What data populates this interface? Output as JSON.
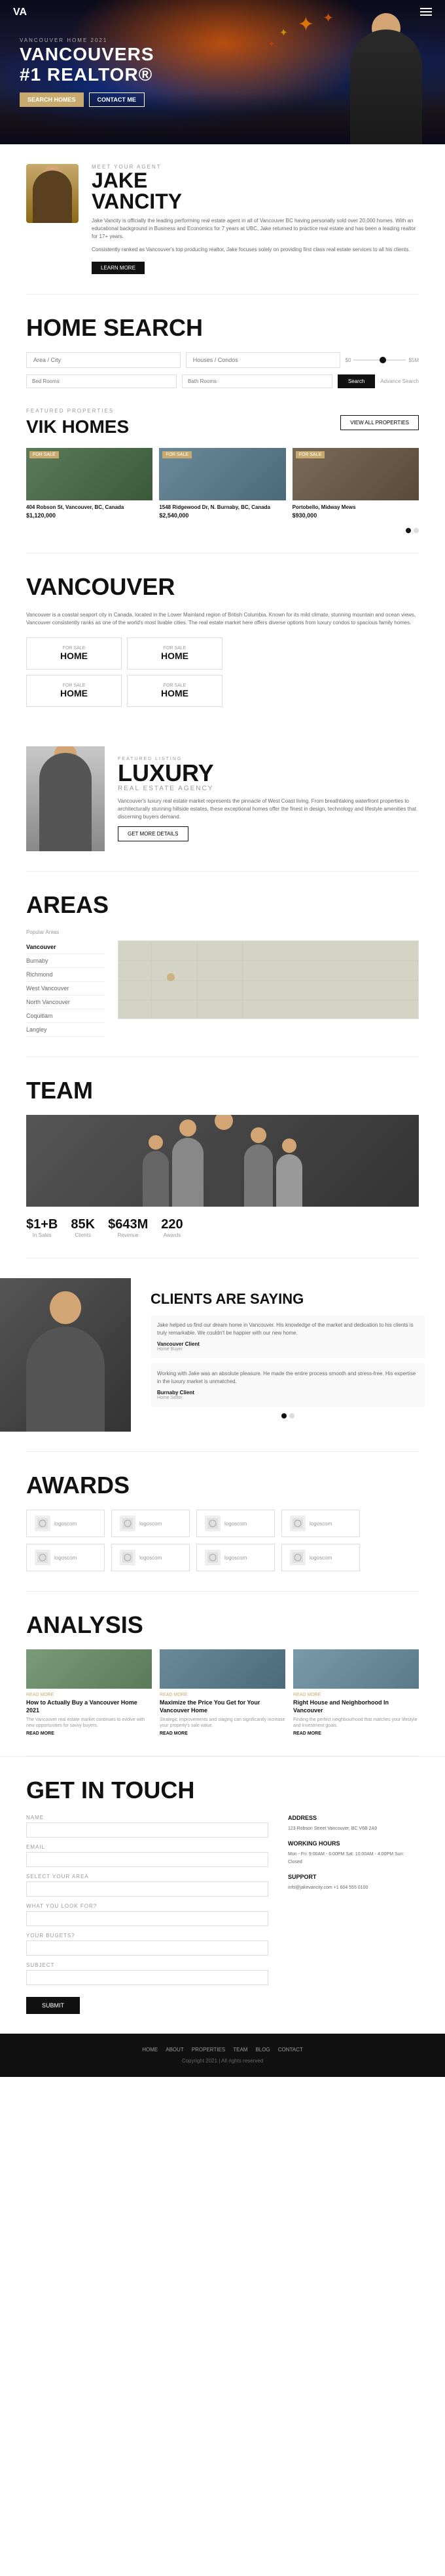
{
  "hero": {
    "logo": "VA",
    "title_line1": "VANCOUVERS",
    "title_line2": "#1 REALTOR®",
    "award_label": "Vancouver Home 2021",
    "btn_search": "SEARCH HOMES",
    "btn_contact": "CONTACT ME"
  },
  "agent": {
    "label": "MEET YOUR AGENT",
    "first_name": "JAKE",
    "last_name": "VANCITY",
    "description": "Jake Vancity is officially the leading performing real estate agent in all of Vancouver BC having personally sold over 20,000 homes. With an educational background in Business and Economics for 7 years at UBC, Jake returned to practice real estate and has been a leading realtor for 17+ years.",
    "description2": "Consistently ranked as Vancouver's top producing realtor, Jake focuses solely on providing first class real estate services to all his clients.",
    "btn": "LEARN MORE"
  },
  "home_search": {
    "title": "HOME SEARCH",
    "area_placeholder": "Area / City",
    "house_placeholder": "Houses / Condos",
    "price_min": "$0",
    "price_max": "$5M",
    "beds_placeholder": "Bed Rooms",
    "baths_placeholder": "Bath Rooms",
    "search_btn": "Search",
    "advanced_link": "Advance Search"
  },
  "featured": {
    "label": "FEATURED PROPERTIES",
    "title": "VIK HOMES",
    "homes": [
      {
        "badge": "FOR SALE",
        "address": "404 Robson St, Vancouver, BC, Canada",
        "price": "$1,120,000"
      },
      {
        "badge": "FOR SALE",
        "address": "1548 Ridgewood Dr, N. Burnaby, BC, Canada",
        "price": "$2,540,000"
      },
      {
        "badge": "FOR SALE",
        "address": "Portobello, Midway Mews",
        "price": "$930,000"
      }
    ],
    "view_all": "VIEW ALL PROPERTIES"
  },
  "vancouver": {
    "title": "VANCOUVER",
    "description": "Vancouver is a coastal seaport city in Canada, located in the Lower Mainland region of British Columbia. Known for its mild climate, stunning mountain and ocean views, Vancouver consistently ranks as one of the world's most livable cities. The real estate market here offers diverse options from luxury condos to spacious family homes.",
    "home_types": [
      {
        "label": "FOR SALE",
        "value": "HOME"
      },
      {
        "label": "FOR SALE",
        "value": "HOME"
      },
      {
        "label": "FOR SALE",
        "value": "HOME"
      },
      {
        "label": "FOR SALE",
        "value": "HOME"
      }
    ]
  },
  "luxury": {
    "label": "FEATURED LISTING",
    "title": "LUXURY",
    "subtitle": "REAL ESTATE AGENCY",
    "description": "Vancouver's luxury real estate market represents the pinnacle of West Coast living. From breathtaking waterfront properties to architecturally stunning hillside estates, these exceptional homes offer the finest in design, technology and lifestyle amenities that discerning buyers demand.",
    "btn": "GET MORE DETAILS"
  },
  "areas": {
    "title": "AREAS",
    "label": "Popular Areas",
    "items": [
      {
        "name": "Vancouver",
        "active": true
      },
      {
        "name": "Burnaby"
      },
      {
        "name": "Richmond"
      },
      {
        "name": "West Vancouver"
      },
      {
        "name": "North Vancouver"
      },
      {
        "name": "Coquitlam"
      },
      {
        "name": "Langley"
      }
    ]
  },
  "team": {
    "title": "TEAM",
    "stats": [
      {
        "value": "$1+B",
        "label": "In Sales"
      },
      {
        "value": "85K",
        "label": "Clients"
      },
      {
        "value": "$643M",
        "label": "Revenue"
      },
      {
        "value": "220",
        "label": "Awards"
      }
    ]
  },
  "clients": {
    "title": "CLIENTS ARE SAYING",
    "testimonials": [
      {
        "text": "Jake helped us find our dream home in Vancouver. His knowledge of the market and dedication to his clients is truly remarkable. We couldn't be happier with our new home.",
        "name": "Vancouver Client",
        "role": "Home Buyer"
      },
      {
        "text": "Working with Jake was an absolute pleasure. He made the entire process smooth and stress-free. His expertise in the luxury market is unmatched.",
        "name": "Burnaby Client",
        "role": "Home Seller"
      }
    ]
  },
  "awards": {
    "title": "AWARDS",
    "items": [
      {
        "name": "logoscom"
      },
      {
        "name": "logoscom"
      },
      {
        "name": "logoscom"
      },
      {
        "name": "logoscom"
      },
      {
        "name": "logoscom"
      },
      {
        "name": "logoscom"
      },
      {
        "name": "logoscom"
      },
      {
        "name": "logoscom"
      }
    ]
  },
  "analysis": {
    "title": "ANALYSIS",
    "articles": [
      {
        "date": "READ MORE",
        "title": "How to Actually Buy a Vancouver Home 2021",
        "description": "The Vancouver real estate market continues to evolve with new opportunities for savvy buyers.",
        "link": "READ MORE"
      },
      {
        "date": "READ MORE",
        "title": "Maximize the Price You Get for Your Vancouver Home",
        "description": "Strategic improvements and staging can significantly increase your property's sale value.",
        "link": "READ MORE"
      },
      {
        "date": "READ MORE",
        "title": "Right House and Neighborhood In Vancouver",
        "description": "Finding the perfect neighbourhood that matches your lifestyle and investment goals.",
        "link": "READ MORE"
      }
    ]
  },
  "contact": {
    "title": "GET IN TOUCH",
    "fields": {
      "name_label": "NAME",
      "name_placeholder": "",
      "email_label": "EMAIL",
      "email_placeholder": "",
      "area_label": "SELECT YOUR AREA",
      "area_placeholder": "",
      "looking_label": "WHAT YOU LOOK FOR?",
      "looking_placeholder": "",
      "budget_label": "YOUR BUGETS?",
      "budget_placeholder": "",
      "subject_label": "SUBJECT",
      "subject_placeholder": ""
    },
    "submit_btn": "SUBMIT",
    "sidebar": {
      "address_title": "ADDRESS",
      "address": "123 Robson Street\nVancouver, BC\nV6B 2A9",
      "hours_title": "WORKING HOURS",
      "hours": "Mon - Fri: 9:00AM - 6:00PM\nSat: 10:00AM - 4:00PM\nSun: Closed",
      "support_title": "SUPPORT",
      "support": "info@jakevancity.com\n+1 604 555 0100"
    }
  },
  "footer": {
    "copyright": "Copyright 2021 | All rights reserved",
    "nav": [
      "HOME",
      "ABOUT",
      "PROPERTIES",
      "TEAM",
      "BLOG",
      "CONTACT"
    ]
  }
}
